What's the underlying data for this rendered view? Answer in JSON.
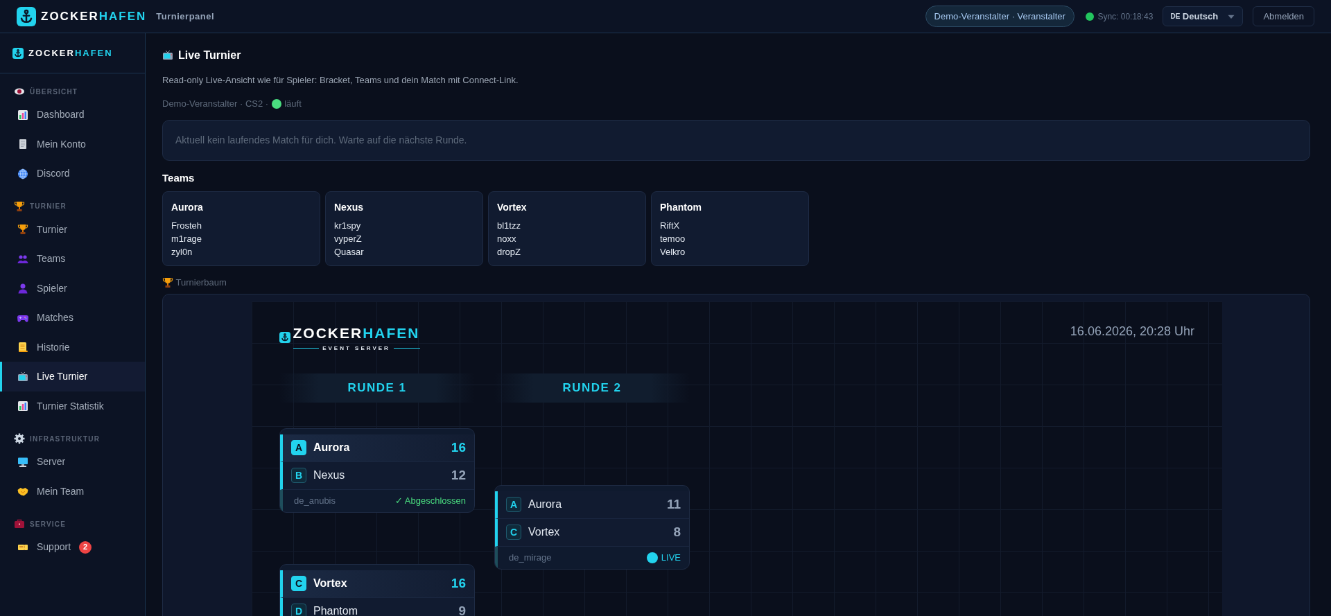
{
  "topbar": {
    "brand": {
      "name_a": "ZOCKER",
      "name_b": "HAFEN"
    },
    "subtitle": "Turnierpanel",
    "user_badge": "Demo-Veranstalter · Veranstalter",
    "sync": "Sync: 00:18:43",
    "language": {
      "flag": "DE",
      "label": "Deutsch"
    },
    "logout": "Abmelden"
  },
  "sidebar": {
    "brand": {
      "name_a": "ZOCKER",
      "name_b": "HAFEN"
    },
    "sections": [
      {
        "title": "ÜBERSICHT",
        "items": [
          {
            "label": "Dashboard",
            "selected": false
          },
          {
            "label": "Mein Konto",
            "selected": false
          },
          {
            "label": "Discord",
            "selected": false
          }
        ]
      },
      {
        "title": "TURNIER",
        "items": [
          {
            "label": "Turnier",
            "selected": false
          },
          {
            "label": "Teams",
            "selected": false
          },
          {
            "label": "Spieler",
            "selected": false
          },
          {
            "label": "Matches",
            "selected": false
          },
          {
            "label": "Historie",
            "selected": false
          },
          {
            "label": "Live Turnier",
            "selected": true
          },
          {
            "label": "Turnier Statistik",
            "selected": false
          }
        ]
      },
      {
        "title": "INFRASTRUKTUR",
        "items": [
          {
            "label": "Server",
            "selected": false
          },
          {
            "label": "Mein Team",
            "selected": false
          }
        ]
      },
      {
        "title": "SERVICE",
        "items": [
          {
            "label": "Support",
            "selected": false,
            "badge": "2"
          }
        ]
      }
    ]
  },
  "page": {
    "title": "Live Turnier",
    "description": "Read-only Live-Ansicht wie für Spieler: Bracket, Teams und dein Match mit Connect-Link.",
    "meta": "Demo-Veranstalter · CS2 ·",
    "status": "läuft",
    "alert": "Aktuell kein laufendes Match für dich. Warte auf die nächste Runde.",
    "teams_heading": "Teams",
    "teams": [
      {
        "name": "Aurora",
        "players": [
          "Frosteh",
          "m1rage",
          "zyl0n"
        ]
      },
      {
        "name": "Nexus",
        "players": [
          "kr1spy",
          "vyperZ",
          "Quasar"
        ]
      },
      {
        "name": "Vortex",
        "players": [
          "bl1tzz",
          "noxx",
          "dropZ"
        ]
      },
      {
        "name": "Phantom",
        "players": [
          "RiftX",
          "temoo",
          "Velkro"
        ]
      }
    ],
    "bracket_heading": "Turnierbaum",
    "bracket": {
      "logo": {
        "name_a": "ZOCKER",
        "name_b": "HAFEN",
        "tagline": "EVENT SERVER"
      },
      "date": "16.06.2026, 20:28 Uhr",
      "rounds": [
        {
          "title": "RUNDE 1",
          "matches": [
            {
              "teams": [
                {
                  "seed": "A",
                  "name": "Aurora",
                  "score": "16",
                  "winner": true
                },
                {
                  "seed": "B",
                  "name": "Nexus",
                  "score": "12",
                  "winner": false
                }
              ],
              "map": "de_anubis",
              "status": {
                "kind": "done",
                "label": "✓ Abgeschlossen"
              }
            },
            {
              "teams": [
                {
                  "seed": "C",
                  "name": "Vortex",
                  "score": "16",
                  "winner": true
                },
                {
                  "seed": "D",
                  "name": "Phantom",
                  "score": "9",
                  "winner": false
                }
              ]
            }
          ]
        },
        {
          "title": "RUNDE 2",
          "matches": [
            {
              "teams": [
                {
                  "seed": "A",
                  "name": "Aurora",
                  "score": "11",
                  "winner": false
                },
                {
                  "seed": "C",
                  "name": "Vortex",
                  "score": "8",
                  "winner": false
                }
              ],
              "map": "de_mirage",
              "status": {
                "kind": "live",
                "label": "LIVE"
              }
            }
          ]
        }
      ]
    }
  }
}
